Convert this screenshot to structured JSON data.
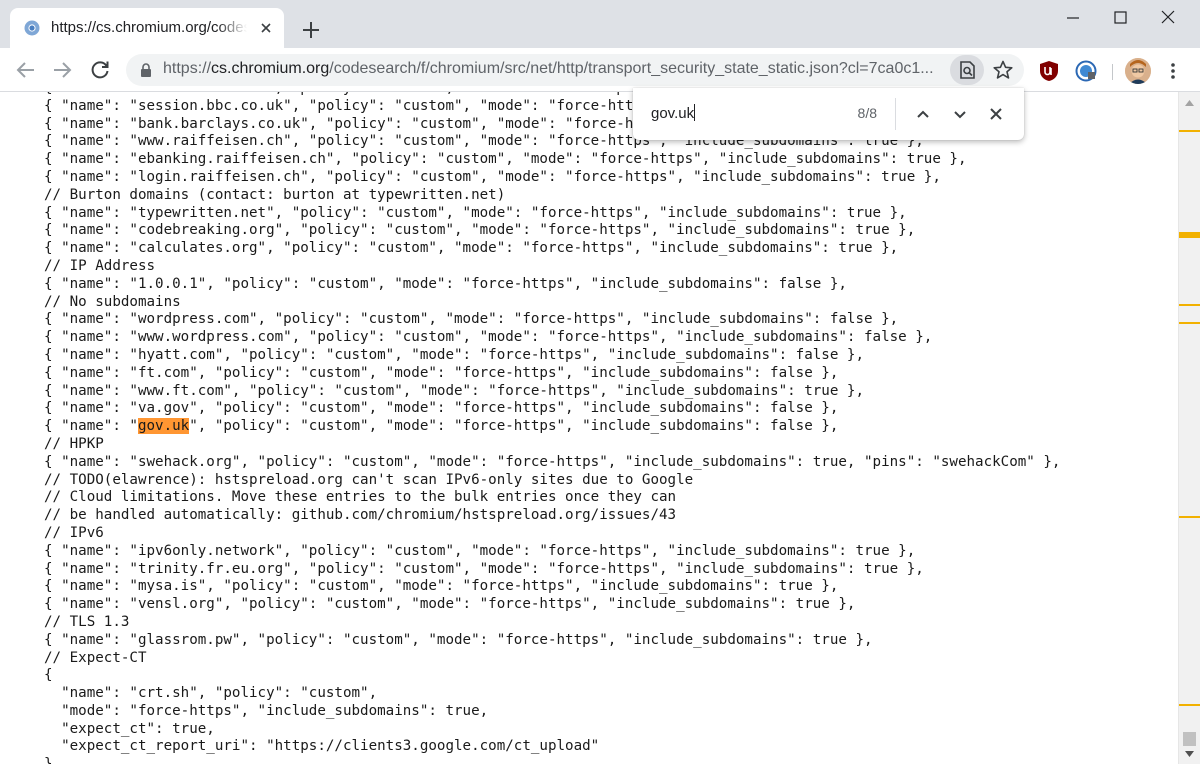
{
  "tab": {
    "title": "https://cs.chromium.org/codesearch"
  },
  "toolbar": {
    "url_prefix": "https://",
    "url_host": "cs.chromium.org",
    "url_path": "/codesearch/f/chromium/src/net/http/transport_security_state_static.json?cl=7ca0c1..."
  },
  "find_bar": {
    "query": "gov.uk",
    "count": "8/8"
  },
  "icons": {
    "favicon": "chromium-favicon-icon",
    "tab_close": "close-icon",
    "new_tab": "plus-icon",
    "back": "arrow-left-icon",
    "forward": "arrow-right-icon",
    "reload": "reload-icon",
    "lock": "lock-icon",
    "find_in_page": "find-in-page-icon",
    "bookmark": "star-icon",
    "ublock": "ublock-origin-icon",
    "https_everywhere": "https-everywhere-icon",
    "menu": "kebab-menu-icon",
    "find_prev": "chevron-up-icon",
    "find_next": "chevron-down-icon",
    "find_close": "close-icon"
  },
  "colors": {
    "find_highlight": "#ff9632",
    "scroll_marker": "#f2b100",
    "tabstrip": "#dee1e6"
  },
  "code": {
    "lines": [
      "{ \"name\": \"session.bbc.com\", \"policy\": \"custom\", \"mode\": \"force-https\" },",
      "{ \"name\": \"session.bbc.co.uk\", \"policy\": \"custom\", \"mode\": \"force-https\" },",
      "{ \"name\": \"bank.barclays.co.uk\", \"policy\": \"custom\", \"mode\": \"force-https\" },",
      "{ \"name\": \"www.raiffeisen.ch\", \"policy\": \"custom\", \"mode\": \"force-https\", \"include_subdomains\": true },",
      "{ \"name\": \"ebanking.raiffeisen.ch\", \"policy\": \"custom\", \"mode\": \"force-https\", \"include_subdomains\": true },",
      "{ \"name\": \"login.raiffeisen.ch\", \"policy\": \"custom\", \"mode\": \"force-https\", \"include_subdomains\": true },",
      "// Burton domains (contact: burton at typewritten.net)",
      "{ \"name\": \"typewritten.net\", \"policy\": \"custom\", \"mode\": \"force-https\", \"include_subdomains\": true },",
      "{ \"name\": \"codebreaking.org\", \"policy\": \"custom\", \"mode\": \"force-https\", \"include_subdomains\": true },",
      "{ \"name\": \"calculates.org\", \"policy\": \"custom\", \"mode\": \"force-https\", \"include_subdomains\": true },",
      "// IP Address",
      "{ \"name\": \"1.0.0.1\", \"policy\": \"custom\", \"mode\": \"force-https\", \"include_subdomains\": false },",
      "// No subdomains",
      "{ \"name\": \"wordpress.com\", \"policy\": \"custom\", \"mode\": \"force-https\", \"include_subdomains\": false },",
      "{ \"name\": \"www.wordpress.com\", \"policy\": \"custom\", \"mode\": \"force-https\", \"include_subdomains\": false },",
      "{ \"name\": \"hyatt.com\", \"policy\": \"custom\", \"mode\": \"force-https\", \"include_subdomains\": false },",
      "{ \"name\": \"ft.com\", \"policy\": \"custom\", \"mode\": \"force-https\", \"include_subdomains\": false },",
      "{ \"name\": \"www.ft.com\", \"policy\": \"custom\", \"mode\": \"force-https\", \"include_subdomains\": true },",
      "{ \"name\": \"va.gov\", \"policy\": \"custom\", \"mode\": \"force-https\", \"include_subdomains\": false },",
      "{ \"name\": \"gov.uk\", \"policy\": \"custom\", \"mode\": \"force-https\", \"include_subdomains\": false },",
      "// HPKP",
      "{ \"name\": \"swehack.org\", \"policy\": \"custom\", \"mode\": \"force-https\", \"include_subdomains\": true, \"pins\": \"swehackCom\" },",
      "// TODO(elawrence): hstspreload.org can't scan IPv6-only sites due to Google",
      "// Cloud limitations. Move these entries to the bulk entries once they can",
      "// be handled automatically: github.com/chromium/hstspreload.org/issues/43",
      "// IPv6",
      "{ \"name\": \"ipv6only.network\", \"policy\": \"custom\", \"mode\": \"force-https\", \"include_subdomains\": true },",
      "{ \"name\": \"trinity.fr.eu.org\", \"policy\": \"custom\", \"mode\": \"force-https\", \"include_subdomains\": true },",
      "{ \"name\": \"mysa.is\", \"policy\": \"custom\", \"mode\": \"force-https\", \"include_subdomains\": true },",
      "{ \"name\": \"vensl.org\", \"policy\": \"custom\", \"mode\": \"force-https\", \"include_subdomains\": true },",
      "// TLS 1.3",
      "{ \"name\": \"glassrom.pw\", \"policy\": \"custom\", \"mode\": \"force-https\", \"include_subdomains\": true },",
      "// Expect-CT",
      "{",
      "  \"name\": \"crt.sh\", \"policy\": \"custom\",",
      "  \"mode\": \"force-https\", \"include_subdomains\": true,",
      "  \"expect_ct\": true,",
      "  \"expect_ct_report_uri\": \"https://clients3.google.com/ct_upload\"",
      "},"
    ]
  }
}
